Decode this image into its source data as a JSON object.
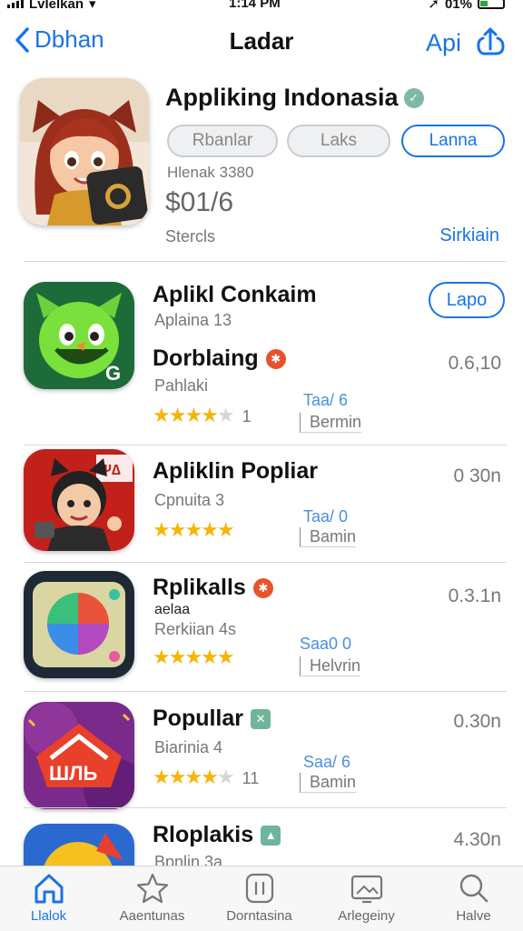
{
  "status_bar": {
    "carrier": "Lvlelkan",
    "time": "1:14 PM",
    "battery": "01%"
  },
  "nav": {
    "back_label": "Dbhan",
    "title": "Ladar",
    "right_label": "Api"
  },
  "hero": {
    "title": "Appliking Indonasia",
    "buttons": [
      "Rbanlar",
      "Laks",
      "Lanna"
    ],
    "subtitle": "Hlenak 3380",
    "price": "$01/6",
    "footer": "Stercls",
    "link": "Sirkiain"
  },
  "apps": [
    {
      "name": "Aplikl Conkaim",
      "sub": "Aplaina 13",
      "action": "Lapo",
      "icon": "green-monster-icon"
    },
    {
      "name": "Dorblaing",
      "sub": "Pahlaki",
      "rating": 3.5,
      "rating_count": "1",
      "meta1": "Taa/ 6",
      "meta2": "Bermin",
      "right": "0.6,10",
      "badge_color": "#e8532c",
      "icon": "cartoon-gamer-icon"
    },
    {
      "name": "Apliklin Popliar",
      "sub": "Cpnuita 3",
      "rating": 4.5,
      "rating_count": "",
      "meta1": "Taa/ 0",
      "meta2": "Bamin",
      "right": "0 30n",
      "icon": "ninja-character-icon"
    },
    {
      "name": "Rplikalls",
      "sub": "Rerkiian 4s",
      "sub_top": "aelaa",
      "rating": 5,
      "rating_count": "",
      "meta1": "Saa0 0",
      "meta2": "Helvrin",
      "right": "0.3.1n",
      "badge_color": "#e8532c",
      "icon": "play-store-icon"
    },
    {
      "name": "Popullar",
      "sub": "Biarinia 4",
      "rating": 3.5,
      "rating_count": "11",
      "meta1": "Saa/ 6",
      "meta2": "Bamin",
      "right": "0.30n",
      "badge_color": "#6fb59a",
      "icon": "red-logo-icon"
    },
    {
      "name": "Rloplakis",
      "sub": "Bpnlin 3a",
      "right": "4.30n",
      "badge_color": "#6fb59a",
      "icon": "colorful-app-icon"
    }
  ],
  "tabs": [
    {
      "label": "Llalok",
      "icon": "home-icon",
      "active": true
    },
    {
      "label": "Aaentunas",
      "icon": "star-icon",
      "active": false
    },
    {
      "label": "Dorntasina",
      "icon": "card-icon",
      "active": false
    },
    {
      "label": "Arlegeiny",
      "icon": "picture-icon",
      "active": false
    },
    {
      "label": "Halve",
      "icon": "search-icon",
      "active": false
    }
  ],
  "colors": {
    "accent": "#1a73e8",
    "star": "#f5b50a"
  }
}
